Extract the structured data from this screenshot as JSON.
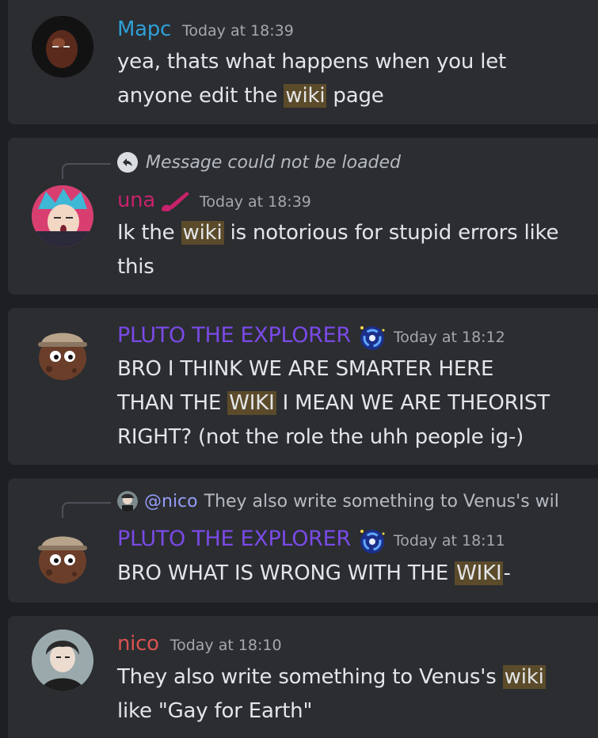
{
  "colors": {
    "background": "#1e1f22",
    "card": "#2b2d31",
    "highlight": "#5b4b2a",
    "mapc": "#2f9fd6",
    "una": "#c7226b",
    "pluto": "#7a4ae6",
    "nico": "#d9534f",
    "mention": "#949cf7"
  },
  "messages": [
    {
      "author": "Марс",
      "timestamp": "Today at 18:39",
      "body": [
        "yea, thats what happens when you let",
        "anyone edit the ",
        "wiki",
        " page"
      ]
    },
    {
      "reply_text": "Message could not be loaded",
      "author": "una",
      "timestamp": "Today at 18:39",
      "body": [
        "Ik the ",
        "wiki",
        " is notorious for stupid errors like",
        "this"
      ]
    },
    {
      "author": "PLUTO THE EXPLORER",
      "timestamp": "Today at 18:12",
      "body": [
        "BRO I THINK WE ARE SMARTER HERE",
        "THAN THE ",
        "WIKI",
        " I MEAN WE ARE THEORIST",
        "RIGHT? (not the role the uhh people ig-)"
      ]
    },
    {
      "reply_mention": "@nico",
      "reply_text": "They also write something to Venus's wil",
      "author": "PLUTO THE EXPLORER",
      "timestamp": "Today at 18:11",
      "body": [
        "BRO WHAT IS WRONG WITH THE ",
        "WIKI",
        "-"
      ]
    },
    {
      "author": "nico",
      "timestamp": "Today at 18:10",
      "body": [
        "They also write something to Venus's ",
        "wiki",
        "like \"Gay for Earth\""
      ]
    }
  ],
  "icons": {
    "reply": "reply-arrow-icon",
    "una_badge": "paintbrush-icon",
    "pluto_badge": "galaxy-icon"
  }
}
